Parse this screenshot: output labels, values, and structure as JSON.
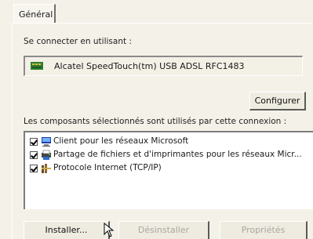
{
  "tabs": [
    {
      "label": "Général"
    }
  ],
  "connect_label": "Se connecter en utilisant :",
  "adapter": {
    "icon": "network-adapter-icon",
    "name": "Alcatel SpeedTouch(tm) USB ADSL RFC1483"
  },
  "configure_label": "Configurer",
  "components_label": "Les composants sélectionnés sont utilisés par cette connexion :",
  "components": [
    {
      "label": "Client pour les réseaux Microsoft",
      "checked": true,
      "icon": "network-client-icon"
    },
    {
      "label": "Partage de fichiers et d'imprimantes pour les réseaux Micr...",
      "checked": true,
      "icon": "printer-share-icon"
    },
    {
      "label": "Protocole Internet (TCP/IP)",
      "checked": true,
      "icon": "protocol-icon"
    }
  ],
  "buttons": {
    "install": "Installer...",
    "uninstall": "Désinstaller",
    "properties": "Propriétés"
  },
  "colors": {
    "dialog_bg": "#f4f1e8",
    "disabled_text": "#a9a6a0"
  }
}
